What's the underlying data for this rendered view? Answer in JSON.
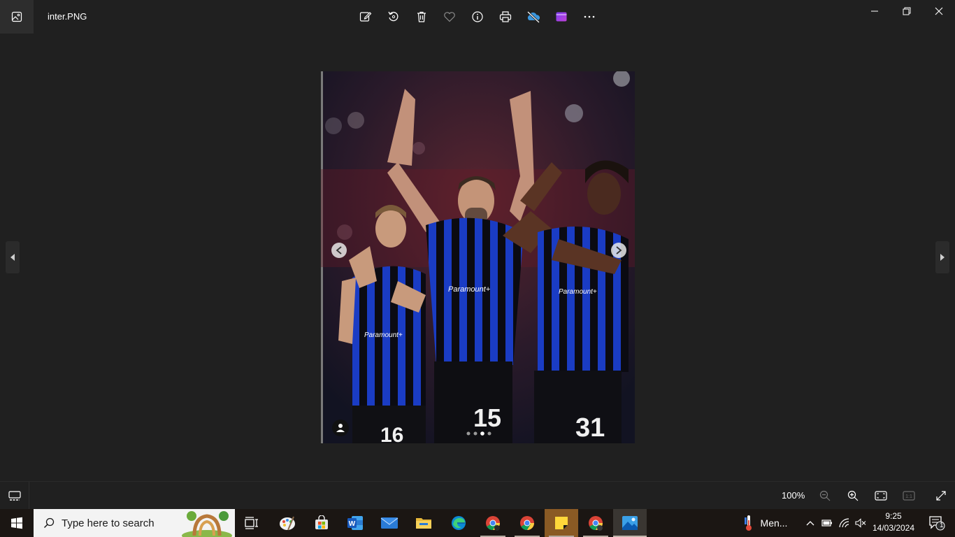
{
  "window": {
    "filename": "inter.PNG"
  },
  "toolbar": {
    "buttons": [
      "edit-image",
      "rotate",
      "delete",
      "favorite",
      "file-info",
      "print",
      "onedrive",
      "clipchamp",
      "see-more"
    ]
  },
  "photo": {
    "players": [
      {
        "number": "16"
      },
      {
        "number": "15"
      },
      {
        "number": "31"
      }
    ],
    "sponsor": "Paramount+",
    "carousel_dots": 4,
    "carousel_active": 3
  },
  "statusbar": {
    "zoom": "100%"
  },
  "taskbar": {
    "search_placeholder": "Type here to search",
    "weather_text": "Men...",
    "time": "9:25",
    "date": "14/03/2024",
    "notifications": "1"
  },
  "colors": {
    "background": "#202020",
    "taskbar": "#1b1613",
    "inter_blue": "#1a3cc4",
    "inter_black": "#0b0b0f"
  }
}
